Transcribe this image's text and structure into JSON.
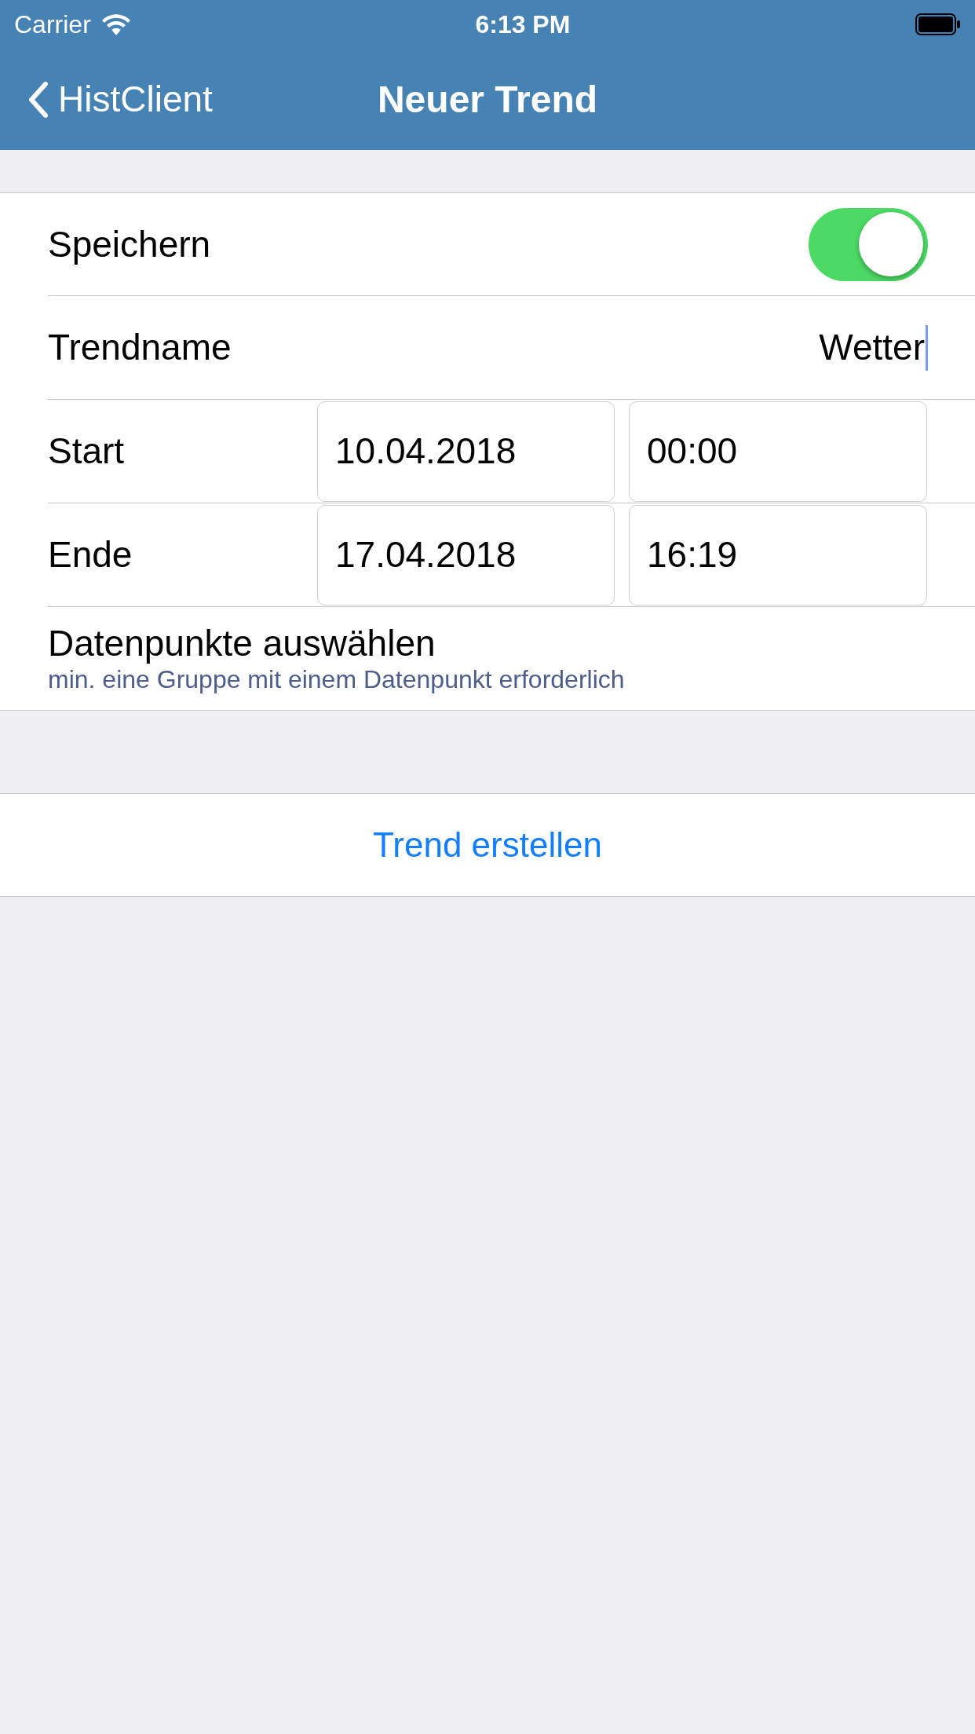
{
  "status_bar": {
    "carrier": "Carrier",
    "time": "6:13 PM"
  },
  "nav": {
    "back_label": "HistClient",
    "title": "Neuer Trend"
  },
  "save_row": {
    "label": "Speichern",
    "on": true
  },
  "trendname_row": {
    "label": "Trendname",
    "value": "Wetter",
    "focused": true
  },
  "range_rows": [
    {
      "label": "Start",
      "date": "10.04.2018",
      "time": "00:00"
    },
    {
      "label": "Ende",
      "date": "17.04.2018",
      "time": "16:19"
    }
  ],
  "datapoints_row": {
    "title": "Datenpunkte auswählen",
    "subtitle": "min. eine Gruppe mit einem Datenpunkt erforderlich"
  },
  "action_button": {
    "label": "Trend erstellen"
  }
}
